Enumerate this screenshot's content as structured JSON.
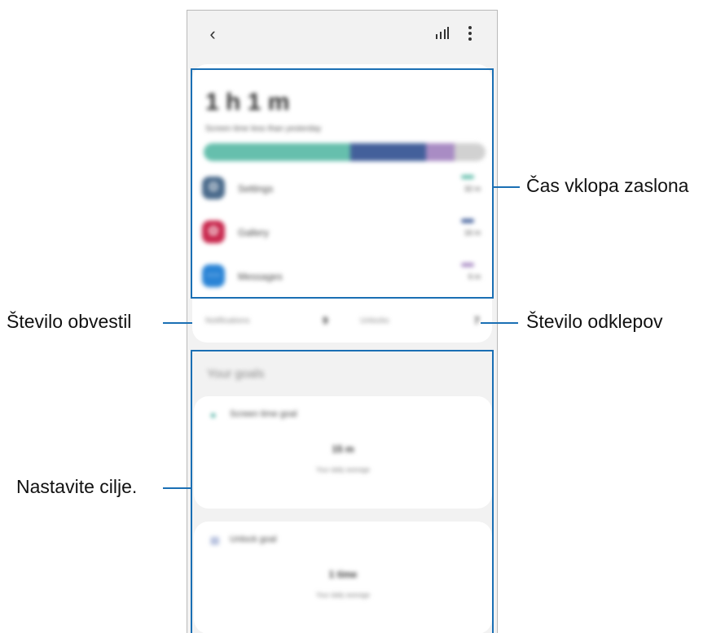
{
  "appbar": {
    "back_icon": "chevron-left-icon",
    "chart_icon": "bar-chart-icon",
    "more_icon": "more-vertical-icon"
  },
  "summary": {
    "total_time": "1 h 1 m",
    "comparison": "Screen time less than yesterday",
    "usage_segments": [
      {
        "color": "#66bfad",
        "fraction": 0.52
      },
      {
        "color": "#43609b",
        "fraction": 0.27
      },
      {
        "color": "#a98cc4",
        "fraction": 0.1
      },
      {
        "color": "#d1d1d1",
        "fraction": 0.11
      }
    ],
    "apps": [
      {
        "name": "Settings",
        "time": "32 m",
        "icon": "settings-icon",
        "icon_color": "#4b6b8c",
        "dash_color": "#66bfad"
      },
      {
        "name": "Gallery",
        "time": "16 m",
        "icon": "gallery-icon",
        "icon_color": "#c92a4f",
        "dash_color": "#43609b"
      },
      {
        "name": "Messages",
        "time": "6 m",
        "icon": "messages-icon",
        "icon_color": "#2a84d6",
        "dash_color": "#a98cc4"
      }
    ]
  },
  "stats": {
    "notifications_label": "Notifications",
    "notifications_value": "9",
    "unlocks_label": "Unlocks",
    "unlocks_value": "7"
  },
  "goals": {
    "title": "Your goals",
    "screen_time": {
      "label": "Screen time goal",
      "value": "15 m",
      "sub": "Your daily average",
      "icon_color": "#3da99a"
    },
    "unlock": {
      "label": "Unlock goal",
      "value": "1 time",
      "sub": "Your daily average",
      "icon_color": "#5a72b5"
    }
  },
  "callouts": {
    "screen_time": "Čas vklopa zaslona",
    "notifications": "Število obvestil",
    "unlocks": "Število odklepov",
    "goals": "Nastavite cilje."
  },
  "accent": "#1a6fb4"
}
